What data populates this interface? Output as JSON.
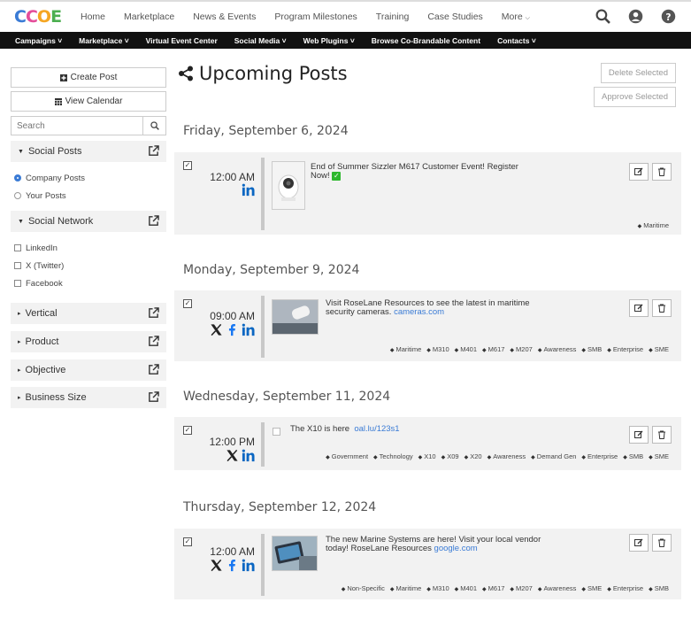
{
  "logo": {
    "letters": [
      "C",
      "C",
      "O",
      "E"
    ]
  },
  "topnav": [
    "Home",
    "Marketplace",
    "News & Events",
    "Program Milestones",
    "Training",
    "Case Studies",
    "More"
  ],
  "subnav": [
    "Campaigns",
    "Marketplace",
    "Virtual Event Center",
    "Social Media",
    "Web Plugins",
    "Browse Co-Brandable Content",
    "Contacts"
  ],
  "sidebar": {
    "create_post": "Create Post",
    "view_calendar": "View Calendar",
    "search_placeholder": "Search",
    "social_posts": "Social Posts",
    "company_posts": "Company Posts",
    "your_posts": "Your Posts",
    "social_network": "Social Network",
    "linkedin": "LinkedIn",
    "twitter": "X (Twitter)",
    "facebook": "Facebook",
    "vertical": "Vertical",
    "product": "Product",
    "objective": "Objective",
    "business_size": "Business Size"
  },
  "main": {
    "title": "Upcoming Posts",
    "delete_selected": "Delete Selected",
    "approve_selected": "Approve Selected",
    "days": [
      {
        "date": "Friday, September 6, 2024",
        "time": "12:00 AM",
        "text": "End of Summer Sizzler M617 Customer Event! Register Now!",
        "link": "",
        "tags": [
          "Maritime"
        ]
      },
      {
        "date": "Monday, September 9, 2024",
        "time": "09:00 AM",
        "text": "Visit  RoseLane Resources to see the latest in maritime security cameras.",
        "link": "cameras.com",
        "tags": [
          "Maritime",
          "M310",
          "M401",
          "M617",
          "M207",
          "Awareness",
          "SMB",
          "Enterprise",
          "SME"
        ]
      },
      {
        "date": "Wednesday, September 11, 2024",
        "time": "12:00 PM",
        "text": "The X10 is here",
        "link": "oal.lu/123s1",
        "tags": [
          "Government",
          "Technology",
          "X10",
          "X09",
          "X20",
          "Awareness",
          "Demand Gen",
          "Enterprise",
          "SMB",
          "SME"
        ]
      },
      {
        "date": "Thursday, September 12, 2024",
        "time": "12:00 AM",
        "text": "The new Marine Systems are here! Visit your local vendor today! RoseLane Resources",
        "link": "google.com",
        "tags": [
          "Non-Specific",
          "Maritime",
          "M310",
          "M401",
          "M617",
          "M207",
          "Awareness",
          "SME",
          "Enterprise",
          "SMB"
        ]
      }
    ]
  },
  "colors": {
    "accent": "#3a7bd5",
    "linkedin": "#0a66c2",
    "facebook": "#1877f2",
    "check_emoji": "#2eb82e"
  }
}
